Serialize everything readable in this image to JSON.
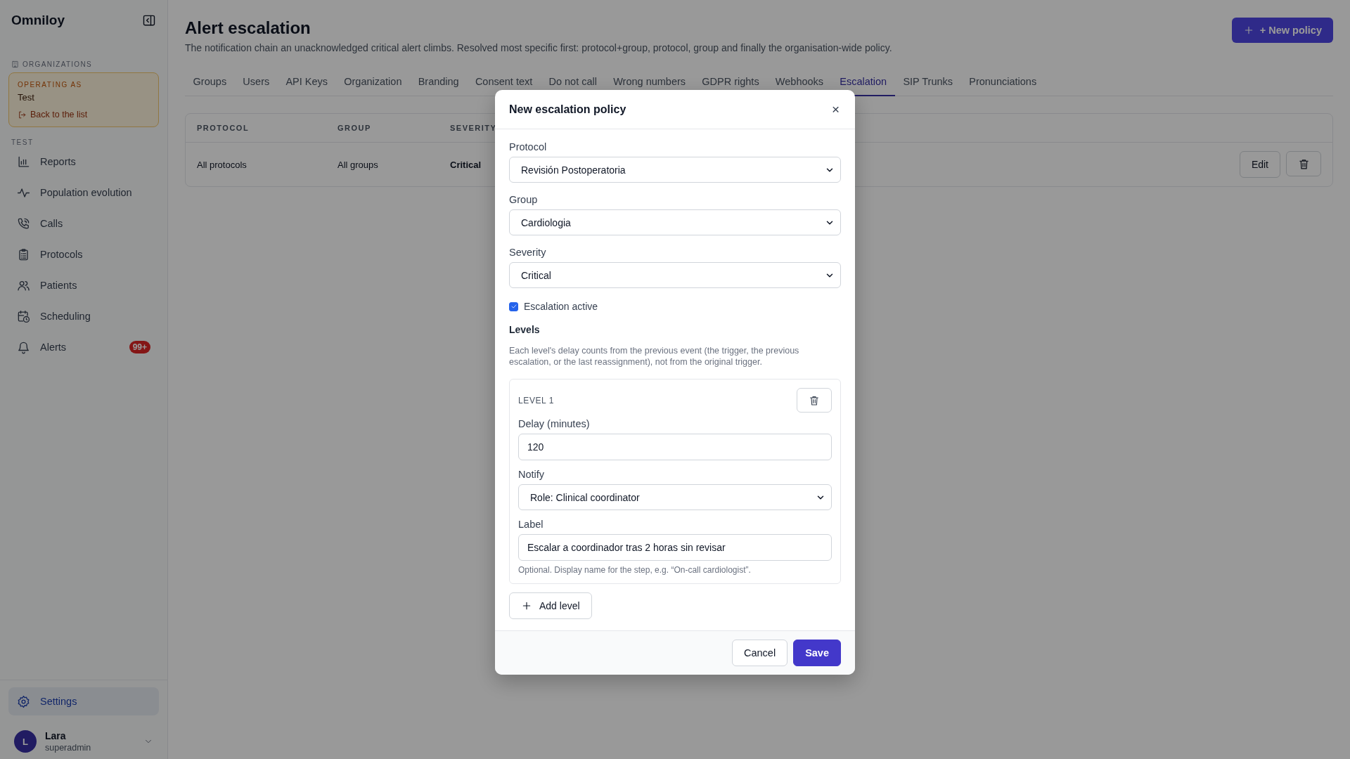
{
  "app": {
    "name": "Omniloy"
  },
  "sidebar": {
    "section_label": "ORGANIZATIONS",
    "org_card": {
      "caption": "OPERATING AS",
      "name": "Test",
      "back_link": "Back to the list"
    },
    "nav_section": "TEST",
    "items": [
      {
        "label": "Reports",
        "selected": false
      },
      {
        "label": "Population evolution",
        "selected": false
      },
      {
        "label": "Calls",
        "selected": false
      },
      {
        "label": "Protocols",
        "selected": false
      },
      {
        "label": "Patients",
        "selected": false
      },
      {
        "label": "Scheduling",
        "selected": false
      },
      {
        "label": "Alerts",
        "selected": false,
        "badge": "99+"
      }
    ],
    "settings": {
      "label": "Settings",
      "selected": true
    },
    "user": {
      "initial": "L",
      "name": "Lara",
      "role": "superadmin"
    }
  },
  "page": {
    "title": "Alert escalation",
    "subtitle": "The notification chain an unacknowledged critical alert climbs. Resolved most specific first: protocol+group, protocol, group and finally the organisation-wide policy.",
    "new_button": "+ New policy"
  },
  "tabs": [
    {
      "label": "Groups",
      "selected": false
    },
    {
      "label": "Users",
      "selected": false
    },
    {
      "label": "API Keys",
      "selected": false
    },
    {
      "label": "Organization",
      "selected": false
    },
    {
      "label": "Branding",
      "selected": false
    },
    {
      "label": "Consent text",
      "selected": false
    },
    {
      "label": "Do not call",
      "selected": false
    },
    {
      "label": "Wrong numbers",
      "selected": false
    },
    {
      "label": "GDPR rights",
      "selected": false
    },
    {
      "label": "Webhooks",
      "selected": false
    },
    {
      "label": "Escalation",
      "selected": true
    },
    {
      "label": "SIP Trunks",
      "selected": false
    },
    {
      "label": "Pronunciations",
      "selected": false
    }
  ],
  "table": {
    "columns": [
      "PROTOCOL",
      "GROUP",
      "SEVERITY"
    ],
    "rows": [
      {
        "cells": [
          "All protocols",
          "All groups",
          "Critical"
        ],
        "edit": "Edit"
      }
    ]
  },
  "modal": {
    "title": "New escalation policy",
    "close": "×",
    "fields": [
      {
        "kind": "select",
        "label": "Protocol",
        "value": "Revisión Postoperatoria"
      },
      {
        "kind": "select",
        "label": "Group",
        "value": "Cardiologia"
      },
      {
        "kind": "select",
        "label": "Severity",
        "value": "Critical"
      }
    ],
    "active": {
      "label": "Escalation active",
      "checked": true
    },
    "levels_heading": "Levels",
    "levels_hint": "Each level's delay counts from the previous event (the trigger, the previous escalation, or the last reassignment), not from the original trigger.",
    "levels": [
      {
        "title": "LEVEL 1",
        "fields": [
          {
            "kind": "input",
            "label": "Delay (minutes)",
            "value": "120"
          },
          {
            "kind": "select",
            "label": "Notify",
            "value": "Role: Clinical coordinator"
          },
          {
            "kind": "input",
            "label": "Label",
            "value": "Escalar a coordinador tras 2 horas sin revisar",
            "hint": "Optional. Display name for the step, e.g. “On-call cardiologist”."
          }
        ]
      }
    ],
    "add_button": "Add level",
    "buttons": [
      {
        "label": "Cancel",
        "kind": "secondary"
      },
      {
        "label": "Save",
        "kind": "primary"
      }
    ]
  }
}
